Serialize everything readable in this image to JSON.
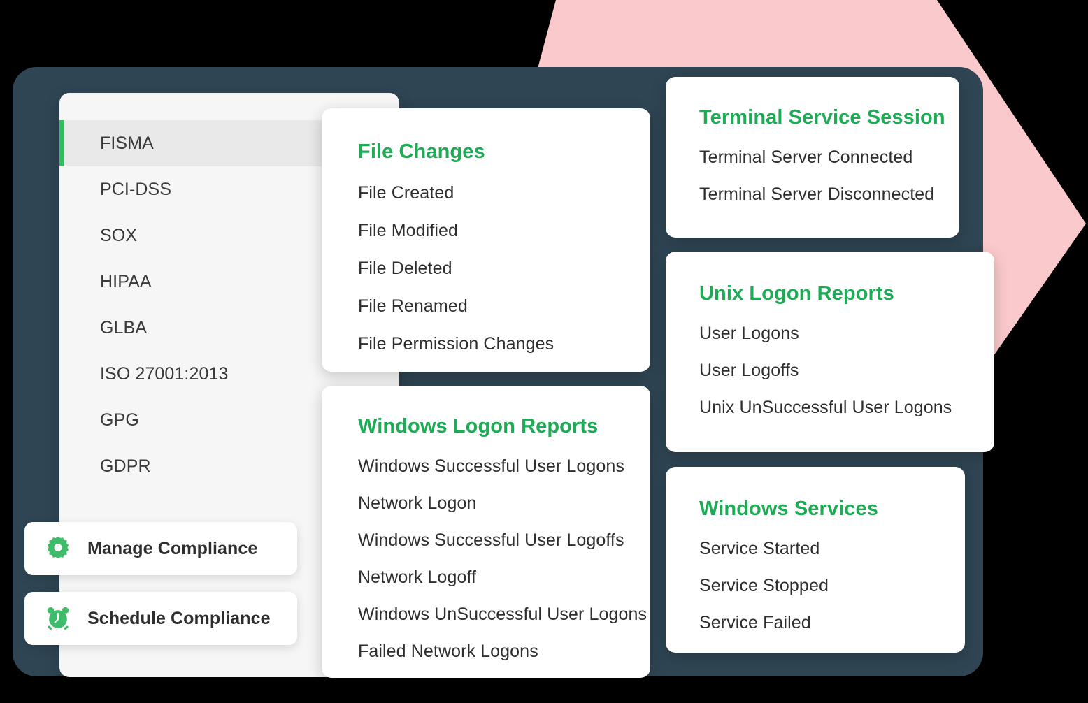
{
  "colors": {
    "accent_green": "#1faa55",
    "icon_green": "#3fbc69",
    "active_bar_green": "#2fbf5f",
    "dark_teal": "#2f4553",
    "pink": "#fac9cb",
    "sidebar_bg": "#f6f6f6",
    "active_item_bg": "#e9e9e9",
    "card_bg": "#ffffff",
    "text_dark": "#2e2e2e",
    "page_bg": "#000000"
  },
  "sidebar": {
    "items": [
      {
        "label": "FISMA",
        "active": true
      },
      {
        "label": "PCI-DSS",
        "active": false
      },
      {
        "label": "SOX",
        "active": false
      },
      {
        "label": "HIPAA",
        "active": false
      },
      {
        "label": "GLBA",
        "active": false
      },
      {
        "label": "ISO 27001:2013",
        "active": false
      },
      {
        "label": "GPG",
        "active": false
      },
      {
        "label": "GDPR",
        "active": false
      }
    ]
  },
  "actions": [
    {
      "label": "Manage Compliance",
      "icon": "gear-icon"
    },
    {
      "label": "Schedule Compliance",
      "icon": "alarm-clock-icon"
    }
  ],
  "cards": {
    "file_changes": {
      "title": "File Changes",
      "items": [
        "File Created",
        "File Modified",
        "File Deleted",
        "File Renamed",
        "File Permission Changes"
      ]
    },
    "windows_logon": {
      "title": "Windows Logon Reports",
      "items": [
        "Windows Successful User Logons",
        "Network Logon",
        "Windows Successful User Logoffs",
        "Network Logoff",
        "Windows UnSuccessful User Logons",
        "Failed Network Logons"
      ]
    },
    "terminal_service": {
      "title": "Terminal Service Session",
      "items": [
        "Terminal Server Connected",
        "Terminal Server Disconnected"
      ]
    },
    "unix_logon": {
      "title": "Unix Logon Reports",
      "items": [
        "User Logons",
        "User Logoffs",
        "Unix UnSuccessful User Logons"
      ]
    },
    "windows_services": {
      "title": "Windows Services",
      "items": [
        "Service Started",
        "Service Stopped",
        "Service Failed"
      ]
    }
  }
}
